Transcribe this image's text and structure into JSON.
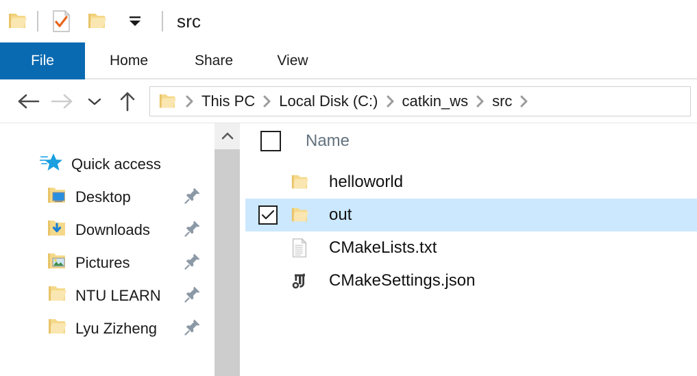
{
  "window": {
    "title": "src",
    "qat": {
      "folder_icon": "folder-icon",
      "properties_icon": "properties-check-document-icon",
      "new_folder_icon": "new-folder-icon",
      "dropdown_icon": "customize-dropdown-icon"
    }
  },
  "ribbon": {
    "tabs": [
      {
        "label": "File",
        "active": true
      },
      {
        "label": "Home",
        "active": false
      },
      {
        "label": "Share",
        "active": false
      },
      {
        "label": "View",
        "active": false
      }
    ],
    "accent_color": "#0a6ab1"
  },
  "navbar": {
    "back_icon": "back-arrow-icon",
    "forward_icon": "forward-arrow-icon",
    "recent_icon": "recent-locations-chevron-icon",
    "up_icon": "up-arrow-icon",
    "address_folder_icon": "folder-icon",
    "breadcrumbs": [
      "This PC",
      "Local Disk (C:)",
      "catkin_ws",
      "src"
    ],
    "separator": "chevron-right-icon"
  },
  "navpane": {
    "quick_access": {
      "label": "Quick access",
      "icon": "quick-access-star-icon"
    },
    "items": [
      {
        "label": "Desktop",
        "icon": "desktop-folder-icon",
        "pinned": true
      },
      {
        "label": "Downloads",
        "icon": "downloads-folder-icon",
        "pinned": true
      },
      {
        "label": "Pictures",
        "icon": "pictures-folder-icon",
        "pinned": true
      },
      {
        "label": "NTU LEARN",
        "icon": "folder-icon",
        "pinned": true
      },
      {
        "label": "Lyu Zizheng",
        "icon": "folder-icon",
        "pinned": true
      }
    ],
    "pin_icon": "pin-icon",
    "scrollbar": {
      "up_icon": "scroll-up-arrow-icon"
    }
  },
  "filelist": {
    "header": {
      "checkbox_checked": false,
      "name_label": "Name"
    },
    "selection_color": "#cce8ff",
    "rows": [
      {
        "name": "helloworld",
        "icon": "folder-icon",
        "checked": false,
        "selected": false
      },
      {
        "name": "out",
        "icon": "folder-icon",
        "checked": true,
        "selected": true
      },
      {
        "name": "CMakeLists.txt",
        "icon": "text-file-icon",
        "checked": false,
        "selected": false
      },
      {
        "name": "CMakeSettings.json",
        "icon": "json-file-icon",
        "checked": false,
        "selected": false
      }
    ]
  }
}
